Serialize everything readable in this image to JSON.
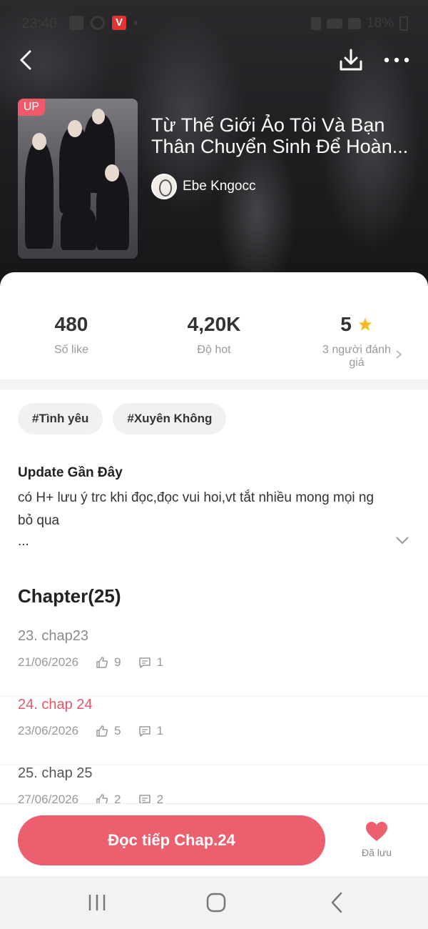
{
  "status": {
    "time": "23:40",
    "battery": "18%"
  },
  "book": {
    "badge": "UP",
    "title_line1": "Từ Thế Giới Ảo Tôi Và Bạn",
    "title_line2": "Thân Chuyển Sinh Để Hoàn...",
    "author": "Ebe Kngocc"
  },
  "stats": {
    "likes": {
      "value": "480",
      "label": "Số like"
    },
    "hot": {
      "value": "4,20K",
      "label": "Độ hot"
    },
    "rating": {
      "value": "5",
      "label_line1": "3 người đánh",
      "label_line2": "giá"
    }
  },
  "tags": [
    "#Tình yêu",
    "#Xuyên Không"
  ],
  "update": {
    "title": "Update Gần Đây",
    "text": "có H+ lưu ý trc khi đọc,đọc vui hoi,vt tắt nhiều mong mọi ng bỏ qua",
    "ellipsis": "..."
  },
  "chapters": {
    "header": "Chapter(25)",
    "items": [
      {
        "title": "23. chap23",
        "date": "21/06/2026",
        "likes": "9",
        "comments": "1",
        "state": "read"
      },
      {
        "title": "24. chap 24",
        "date": "23/06/2026",
        "likes": "5",
        "comments": "1",
        "state": "current"
      },
      {
        "title": "25. chap 25",
        "date": "27/06/2026",
        "likes": "2",
        "comments": "2",
        "state": "unread"
      }
    ]
  },
  "actions": {
    "continue_label": "Đọc tiếp Chap.24",
    "saved_label": "Đã lưu"
  },
  "colors": {
    "accent": "#ec5f6f",
    "badge": "#ef5b6a",
    "star": "#f5b922"
  },
  "icons": [
    "back-icon",
    "download-icon",
    "more-icon",
    "star-icon",
    "chevron-right-icon",
    "chevron-down-icon",
    "like-icon",
    "comment-icon",
    "heart-icon",
    "recents-icon",
    "home-icon",
    "nav-back-icon"
  ]
}
